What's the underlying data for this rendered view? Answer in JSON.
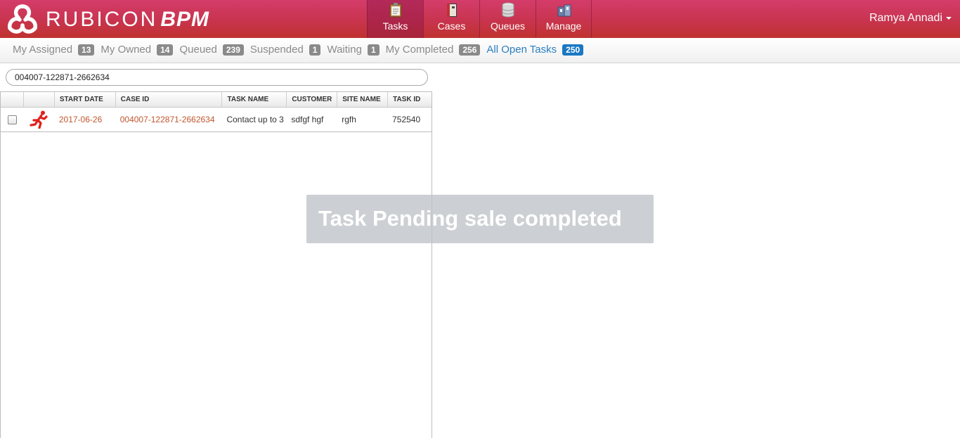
{
  "header": {
    "brand_main": "RUBICON",
    "brand_sub": "BPM",
    "nav": [
      {
        "label": "Tasks",
        "icon": "clipboard-icon",
        "active": true
      },
      {
        "label": "Cases",
        "icon": "binder-icon"
      },
      {
        "label": "Queues",
        "icon": "database-icon"
      },
      {
        "label": "Manage",
        "icon": "folders-icon"
      }
    ],
    "user_name": "Ramya Annadi"
  },
  "filters": [
    {
      "label": "My Assigned",
      "count": "13"
    },
    {
      "label": "My Owned",
      "count": "14"
    },
    {
      "label": "Queued",
      "count": "239"
    },
    {
      "label": "Suspended",
      "count": "1"
    },
    {
      "label": "Waiting",
      "count": "1"
    },
    {
      "label": "My Completed",
      "count": "256"
    },
    {
      "label": "All Open Tasks",
      "count": "250",
      "active": true
    }
  ],
  "search": {
    "value": "004007-122871-2662634"
  },
  "grid": {
    "columns": [
      "",
      "",
      "START DATE",
      "CASE ID",
      "TASK NAME",
      "CUSTOMER",
      "SITE NAME",
      "TASK ID"
    ],
    "rows": [
      {
        "start_date": "2017-06-26",
        "case_id": "004007-122871-2662634",
        "task_name": "Contact up to 3",
        "customer": "sdfgf hgf",
        "site_name": "rgfh",
        "task_id": "752540",
        "icon": "running-person-icon"
      }
    ]
  },
  "toast": {
    "message": "Task Pending sale completed"
  },
  "colors": {
    "header_top": "#d43c6a",
    "header_bottom": "#c0322f",
    "link": "#c0572e",
    "active_filter": "#1a78c2"
  }
}
